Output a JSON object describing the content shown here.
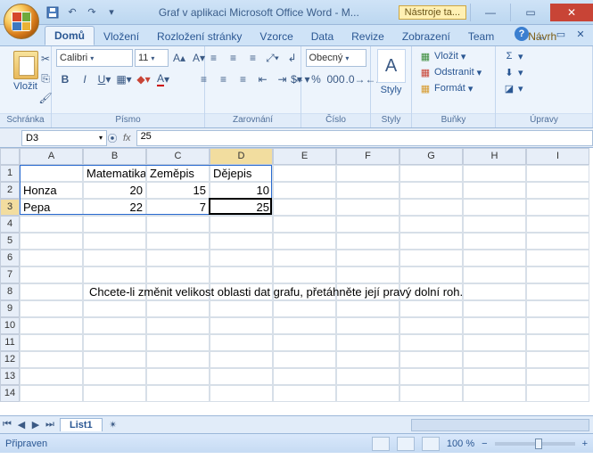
{
  "title": "Graf v aplikaci Microsoft Office Word - M...",
  "tools_tab": "Nástroje ta...",
  "tabs": {
    "domu": "Domů",
    "vlozeni": "Vložení",
    "rozlozeni": "Rozložení stránky",
    "vzorce": "Vzorce",
    "data": "Data",
    "revize": "Revize",
    "zobrazeni": "Zobrazení",
    "team": "Team",
    "navrh": "Návrh"
  },
  "ribbon": {
    "paste": "Vložit",
    "groups": {
      "schranka": "Schránka",
      "pismo": "Písmo",
      "zarovnani": "Zarovnání",
      "cislo": "Číslo",
      "styly": "Styly",
      "bunky": "Buňky",
      "upravy": "Úpravy"
    },
    "font": {
      "name": "Calibri",
      "size": "11"
    },
    "number_format": "Obecný",
    "styly_label": "Styly",
    "styly_letter": "A",
    "cells": {
      "vlozit": "Vložit",
      "odstranit": "Odstranit",
      "format": "Formát"
    }
  },
  "namebox": "D3",
  "formula": "25",
  "columns": [
    "A",
    "B",
    "C",
    "D",
    "E",
    "F",
    "G",
    "H",
    "I"
  ],
  "rows": [
    "1",
    "2",
    "3",
    "4",
    "5",
    "6",
    "7",
    "8",
    "9",
    "10",
    "11",
    "12",
    "13",
    "14"
  ],
  "table": {
    "headers": {
      "b1": "Matematika",
      "c1": "Zeměpis",
      "d1": "Dějepis"
    },
    "r2": {
      "a": "Honza",
      "b": "20",
      "c": "15",
      "d": "10"
    },
    "r3": {
      "a": "Pepa",
      "b": "22",
      "c": "7",
      "d": "25"
    }
  },
  "instruction": "Chcete-li změnit velikost oblasti dat grafu, přetáhněte její pravý dolní roh.",
  "sheet_tab": "List1",
  "status": {
    "ready": "Připraven",
    "zoom": "100 %"
  },
  "chart_data": {
    "type": "table",
    "categories": [
      "Matematika",
      "Zeměpis",
      "Dějepis"
    ],
    "series": [
      {
        "name": "Honza",
        "values": [
          20,
          15,
          10
        ]
      },
      {
        "name": "Pepa",
        "values": [
          22,
          7,
          25
        ]
      }
    ],
    "title": "",
    "xlabel": "",
    "ylabel": ""
  }
}
